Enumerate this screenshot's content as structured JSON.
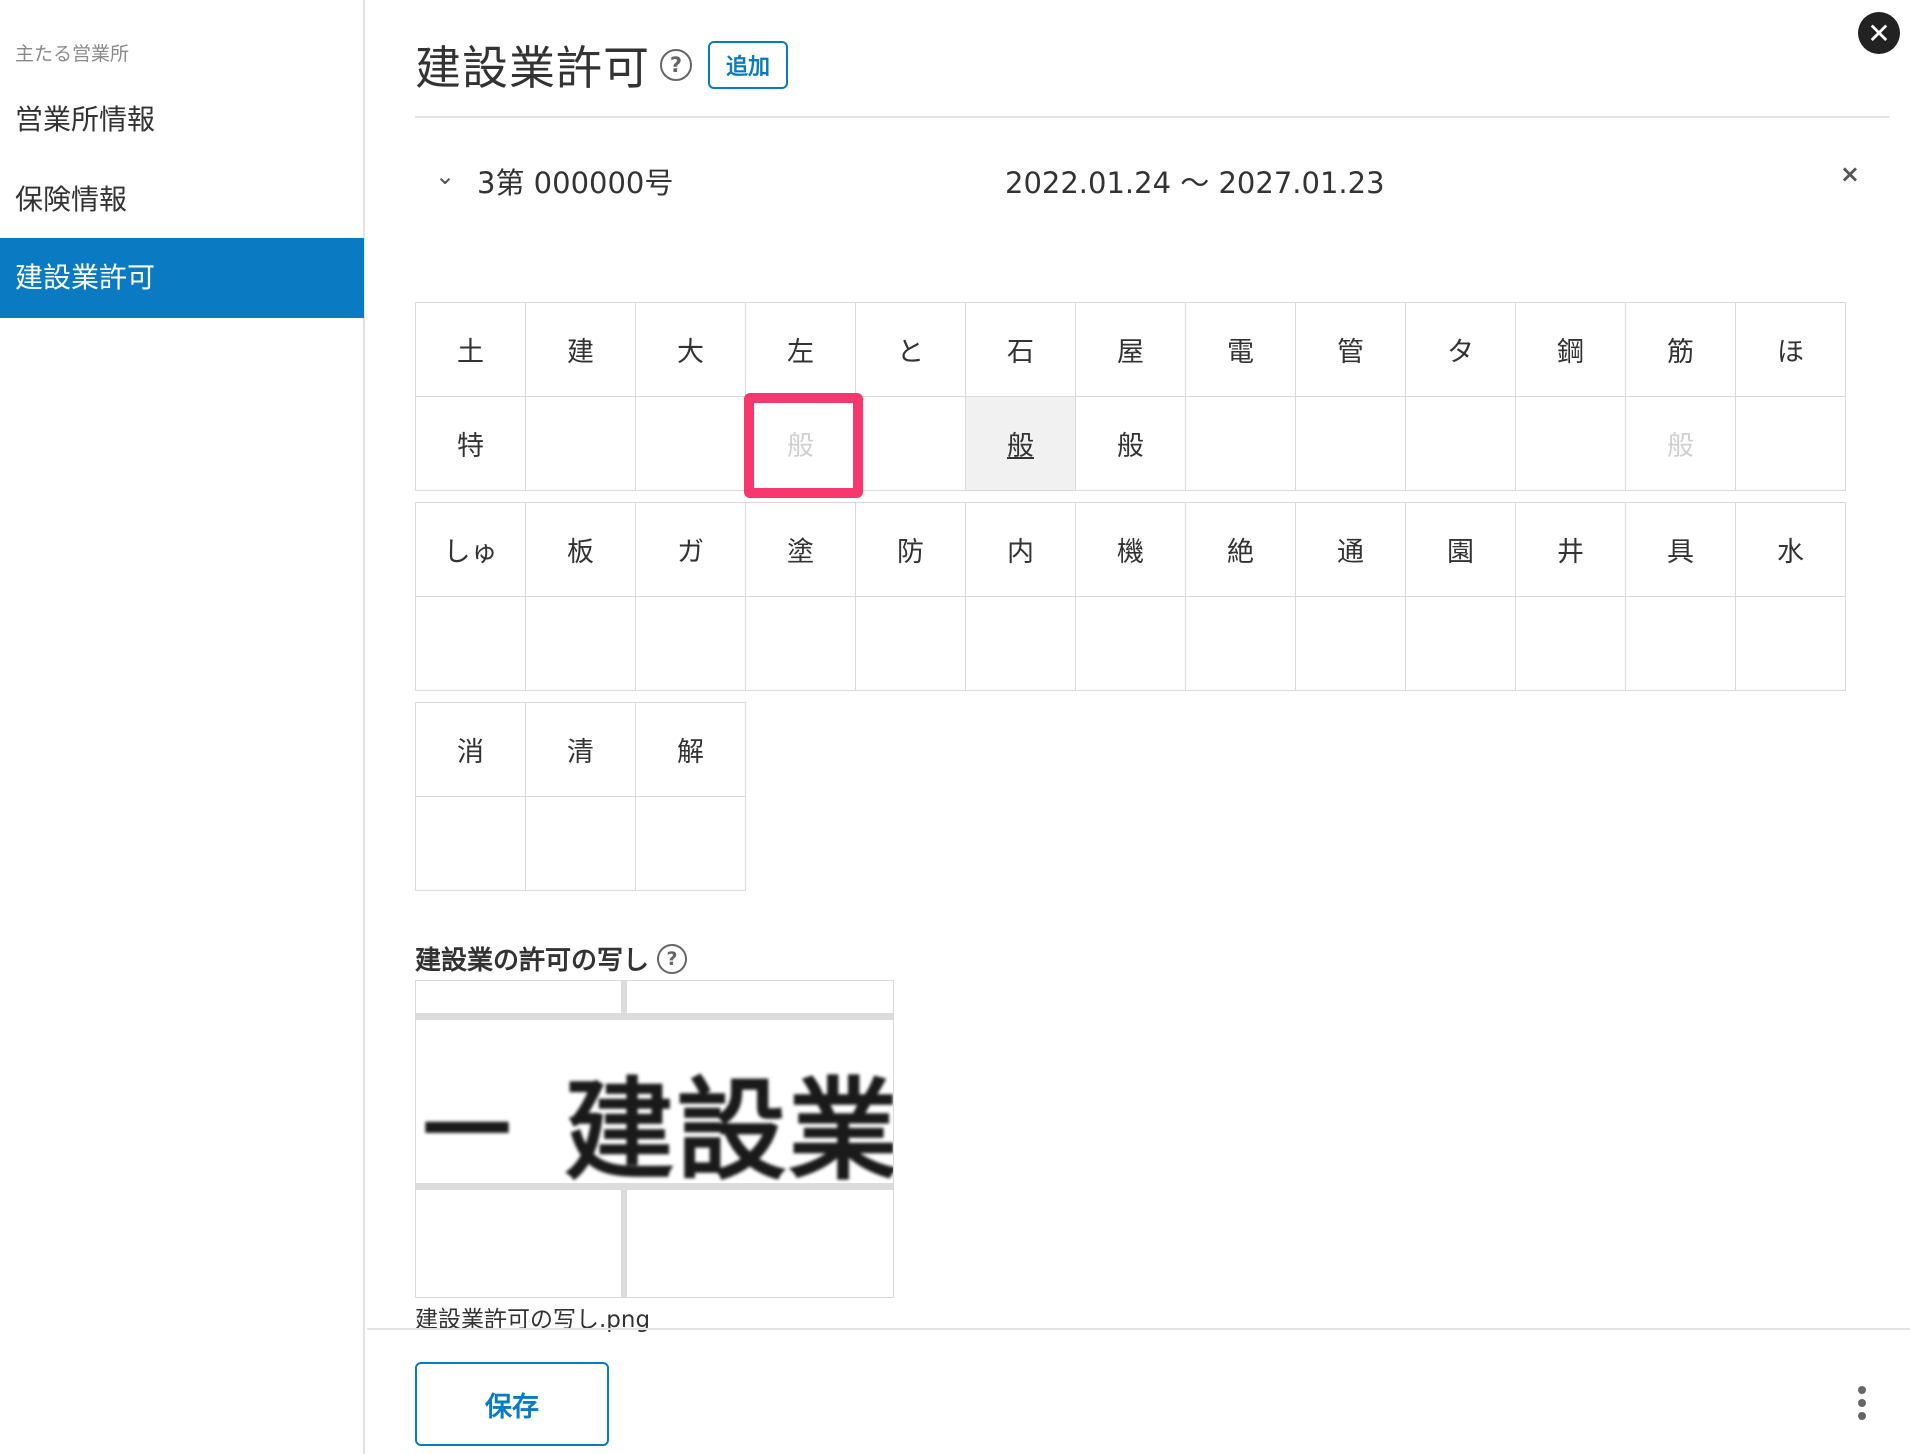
{
  "sidebar": {
    "caption": "主たる営業所",
    "items": [
      {
        "label": "営業所情報"
      },
      {
        "label": "保険情報"
      },
      {
        "label": "建設業許可"
      }
    ]
  },
  "header": {
    "title": "建設業許可",
    "help_glyph": "?",
    "add_label": "追加",
    "close_glyph": "✕"
  },
  "permit": {
    "number": "3第 000000号",
    "period": "2022.01.24 ～ 2027.01.23",
    "chevron_glyph": "⌄",
    "remove_glyph": "×"
  },
  "grid1": {
    "headers": [
      "土",
      "建",
      "大",
      "左",
      "と",
      "石",
      "屋",
      "電",
      "管",
      "タ",
      "鋼",
      "筋",
      "ほ"
    ],
    "values": [
      "特",
      "",
      "",
      "般",
      "",
      "般",
      "般",
      "",
      "",
      "",
      "",
      "般",
      ""
    ]
  },
  "grid2": {
    "headers": [
      "しゅ",
      "板",
      "ガ",
      "塗",
      "防",
      "内",
      "機",
      "絶",
      "通",
      "園",
      "井",
      "具",
      "水"
    ],
    "values": [
      "",
      "",
      "",
      "",
      "",
      "",
      "",
      "",
      "",
      "",
      "",
      "",
      ""
    ]
  },
  "grid3": {
    "headers": [
      "消",
      "清",
      "解"
    ],
    "values": [
      "",
      "",
      ""
    ]
  },
  "copy": {
    "label": "建設業の許可の写し",
    "help_glyph": "?",
    "thumbnail_text": "－ 建設業許",
    "file_name": "建設業許可の写し.png"
  },
  "footer": {
    "save_label": "保存"
  }
}
